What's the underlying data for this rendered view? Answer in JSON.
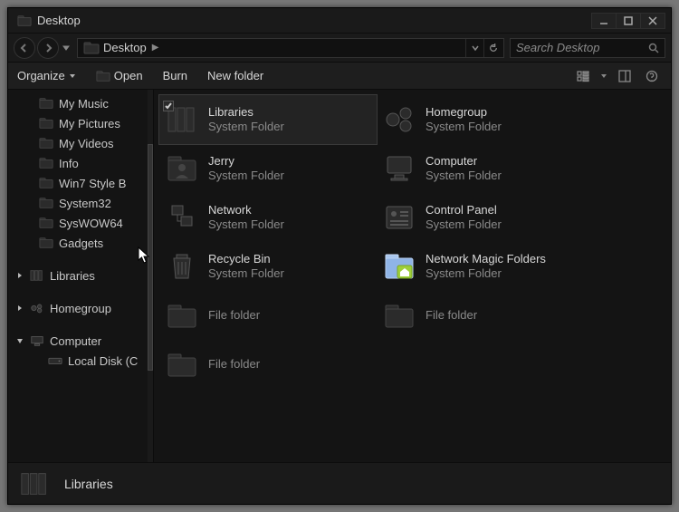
{
  "window": {
    "title": "Desktop"
  },
  "address": {
    "location": "Desktop"
  },
  "search": {
    "placeholder": "Search Desktop"
  },
  "toolbar": {
    "organize": "Organize",
    "open": "Open",
    "burn": "Burn",
    "newfolder": "New folder"
  },
  "sidebar": {
    "items": [
      {
        "label": "My Music"
      },
      {
        "label": "My Pictures"
      },
      {
        "label": "My Videos"
      },
      {
        "label": "Info"
      },
      {
        "label": "Win7 Style B"
      },
      {
        "label": "System32"
      },
      {
        "label": "SysWOW64"
      },
      {
        "label": "Gadgets"
      }
    ],
    "groups": [
      {
        "label": "Libraries",
        "expanded": false
      },
      {
        "label": "Homegroup",
        "expanded": false
      },
      {
        "label": "Computer",
        "expanded": true
      }
    ],
    "computer_children": [
      {
        "label": "Local Disk (C"
      }
    ]
  },
  "content": {
    "items": [
      {
        "label": "Libraries",
        "sub": "System Folder",
        "selected": true,
        "icon": "libraries"
      },
      {
        "label": "Homegroup",
        "sub": "System Folder",
        "icon": "homegroup"
      },
      {
        "label": "Jerry",
        "sub": "System Folder",
        "icon": "user"
      },
      {
        "label": "Computer",
        "sub": "System Folder",
        "icon": "computer"
      },
      {
        "label": "Network",
        "sub": "System Folder",
        "icon": "network"
      },
      {
        "label": "Control Panel",
        "sub": "System Folder",
        "icon": "controlpanel"
      },
      {
        "label": "Recycle Bin",
        "sub": "System Folder",
        "icon": "recycle"
      },
      {
        "label": "Network Magic Folders",
        "sub": "System Folder",
        "icon": "netmagic"
      },
      {
        "label": "",
        "sub": "File folder",
        "icon": "folder"
      },
      {
        "label": "",
        "sub": "File folder",
        "icon": "folder"
      },
      {
        "label": "",
        "sub": "File folder",
        "icon": "folder"
      }
    ]
  },
  "status": {
    "selected_label": "Libraries"
  }
}
